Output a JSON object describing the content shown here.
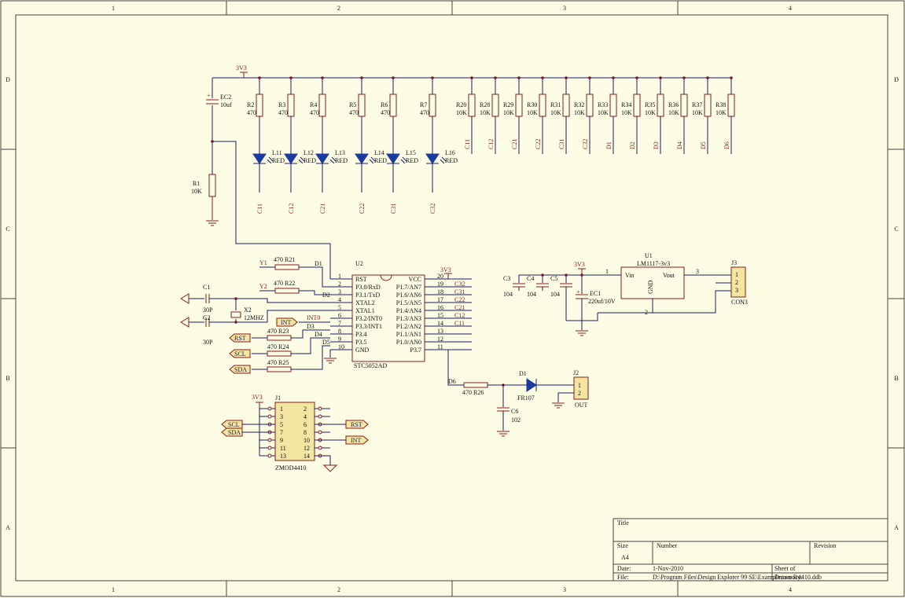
{
  "frame": {
    "col_labels": [
      "1",
      "2",
      "3",
      "4"
    ],
    "row_labels": [
      "D",
      "C",
      "B",
      "A"
    ]
  },
  "title_block": {
    "title_label": "Title",
    "size_label": "Size",
    "size_value": "A4",
    "number_label": "Number",
    "revision_label": "Revision",
    "date_label": "Date:",
    "date_value": "1-Nov-2010",
    "sheet_label": "Sheet    of",
    "file_label": "File:",
    "file_value": "D:\\Program Files\\Design Explorer 99 SE\\Examples\\zmoc4410.ddb",
    "drawn_by_label": "Drawn By:"
  },
  "power": {
    "rail_3v3": "3V3"
  },
  "caps_top": {
    "ec2_ref": "EC2",
    "ec2_val": "10uf"
  },
  "r1": {
    "ref": "R1",
    "val": "10K"
  },
  "led_resistors": [
    {
      "ref": "R2",
      "val": "470"
    },
    {
      "ref": "R3",
      "val": "470"
    },
    {
      "ref": "R4",
      "val": "470"
    },
    {
      "ref": "R5",
      "val": "470"
    },
    {
      "ref": "R6",
      "val": "470"
    },
    {
      "ref": "R7",
      "val": "470"
    }
  ],
  "leds": [
    {
      "ref": "L11",
      "val": "RED",
      "net": "C11"
    },
    {
      "ref": "L12",
      "val": "RED",
      "net": "C12"
    },
    {
      "ref": "L13",
      "val": "RED",
      "net": "C21"
    },
    {
      "ref": "L14",
      "val": "RED",
      "net": "C22"
    },
    {
      "ref": "L15",
      "val": "RED",
      "net": "C31"
    },
    {
      "ref": "L16",
      "val": "RED",
      "net": "C32"
    }
  ],
  "pullups": [
    {
      "ref": "R20",
      "val": "10K",
      "net": "C11"
    },
    {
      "ref": "R28",
      "val": "10K",
      "net": "C12"
    },
    {
      "ref": "R29",
      "val": "10K",
      "net": "C21"
    },
    {
      "ref": "R30",
      "val": "10K",
      "net": "C22"
    },
    {
      "ref": "R31",
      "val": "10K",
      "net": "C31"
    },
    {
      "ref": "R32",
      "val": "10K",
      "net": "C32"
    },
    {
      "ref": "R33",
      "val": "10K",
      "net": "D1"
    },
    {
      "ref": "R34",
      "val": "10K",
      "net": "D2"
    },
    {
      "ref": "R35",
      "val": "10K",
      "net": "D3"
    },
    {
      "ref": "R36",
      "val": "10K",
      "net": "D4"
    },
    {
      "ref": "R37",
      "val": "10K",
      "net": "D5"
    },
    {
      "ref": "R38",
      "val": "10K",
      "net": "D6"
    }
  ],
  "mcu": {
    "ref": "U2",
    "part": "STC5052AD",
    "left_pins": [
      {
        "num": "1",
        "name": "RST"
      },
      {
        "num": "2",
        "name": "P3.0/RxD"
      },
      {
        "num": "3",
        "name": "P3.1/TxD"
      },
      {
        "num": "4",
        "name": "XTAL2"
      },
      {
        "num": "5",
        "name": "XTAL1"
      },
      {
        "num": "6",
        "name": "P3.2/INT0"
      },
      {
        "num": "7",
        "name": "P3.3/INT1"
      },
      {
        "num": "8",
        "name": "P3.4"
      },
      {
        "num": "9",
        "name": "P3.5"
      },
      {
        "num": "10",
        "name": "GND"
      }
    ],
    "right_pins": [
      {
        "num": "20",
        "name": "VCC",
        "net": ""
      },
      {
        "num": "19",
        "name": "P1.7/AN7",
        "net": "C32"
      },
      {
        "num": "18",
        "name": "P1.6/AN6",
        "net": "C31"
      },
      {
        "num": "17",
        "name": "P1.5/AN5",
        "net": "C22"
      },
      {
        "num": "16",
        "name": "P1.4/AN4",
        "net": "C21"
      },
      {
        "num": "15",
        "name": "P1.3/AN3",
        "net": "C12"
      },
      {
        "num": "14",
        "name": "P1.2/AN2",
        "net": "C11"
      },
      {
        "num": "13",
        "name": "P1.1/AN1",
        "net": ""
      },
      {
        "num": "12",
        "name": "P1.0/AN0",
        "net": ""
      },
      {
        "num": "11",
        "name": "P3.7",
        "net": ""
      }
    ]
  },
  "mcu_inputs": {
    "y1": "Y1",
    "y2": "Y2",
    "r21": "470  R21",
    "r22": "470  R22",
    "r23": "470  R23",
    "r24": "470  R24",
    "r25": "470  R25",
    "d1": "D1",
    "d2": "D2",
    "d3": "D3",
    "d4": "D4",
    "d5": "D5",
    "int0": "INT0"
  },
  "crystal": {
    "c1_ref": "C1",
    "c1_val": "30P",
    "c2_ref": "C2",
    "c2_val": "30P",
    "x2_ref": "X2",
    "x2_val": "12MHZ"
  },
  "ports": {
    "int": "INT",
    "rst": "RST",
    "scl": "SCL",
    "sda": "SDA"
  },
  "regulator": {
    "ref": "U1",
    "part": "LM1117-3v3",
    "vin": "Vin",
    "vout": "Vout",
    "gnd": "GND",
    "pin1": "1",
    "pin2": "2",
    "pin3": "3",
    "c3_ref": "C3",
    "c3_val": "104",
    "c4_ref": "C4",
    "c4_val": "104",
    "c5_ref": "C5",
    "c5_val": "104",
    "ec1_ref": "EC1",
    "ec1_val": "220uf/10V"
  },
  "j3": {
    "ref": "J3",
    "part": "CON3",
    "pins": [
      "1",
      "2",
      "3"
    ]
  },
  "output": {
    "d6": "D6",
    "r26": "470  R26",
    "d1_ref": "D1",
    "d1_part": "FR107",
    "c6_ref": "C6",
    "c6_val": "102",
    "j2_ref": "J2",
    "j2_part": "OUT",
    "pins": [
      "1",
      "2"
    ]
  },
  "j1": {
    "ref": "J1",
    "part": "ZMOD4410",
    "left_pins": [
      "1",
      "3",
      "5",
      "7",
      "9",
      "11",
      "13"
    ],
    "right_pins": [
      "2",
      "4",
      "6",
      "8",
      "10",
      "12",
      "14"
    ]
  }
}
